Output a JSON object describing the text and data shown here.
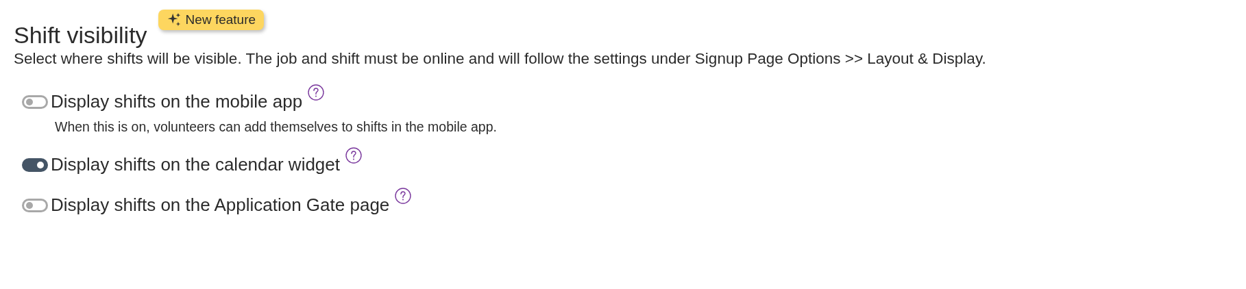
{
  "section": {
    "title": "Shift visibility",
    "badge": "New feature",
    "description": "Select where shifts will be visible. The job and shift must be online and will follow the settings under Signup Page Options >> Layout & Display."
  },
  "options": [
    {
      "label": "Display shifts on the mobile app",
      "on": false,
      "hint": "When this is on, volunteers can add themselves to shifts in the mobile app."
    },
    {
      "label": "Display shifts on the calendar widget",
      "on": true
    },
    {
      "label": "Display shifts on the Application Gate page",
      "on": false
    }
  ]
}
